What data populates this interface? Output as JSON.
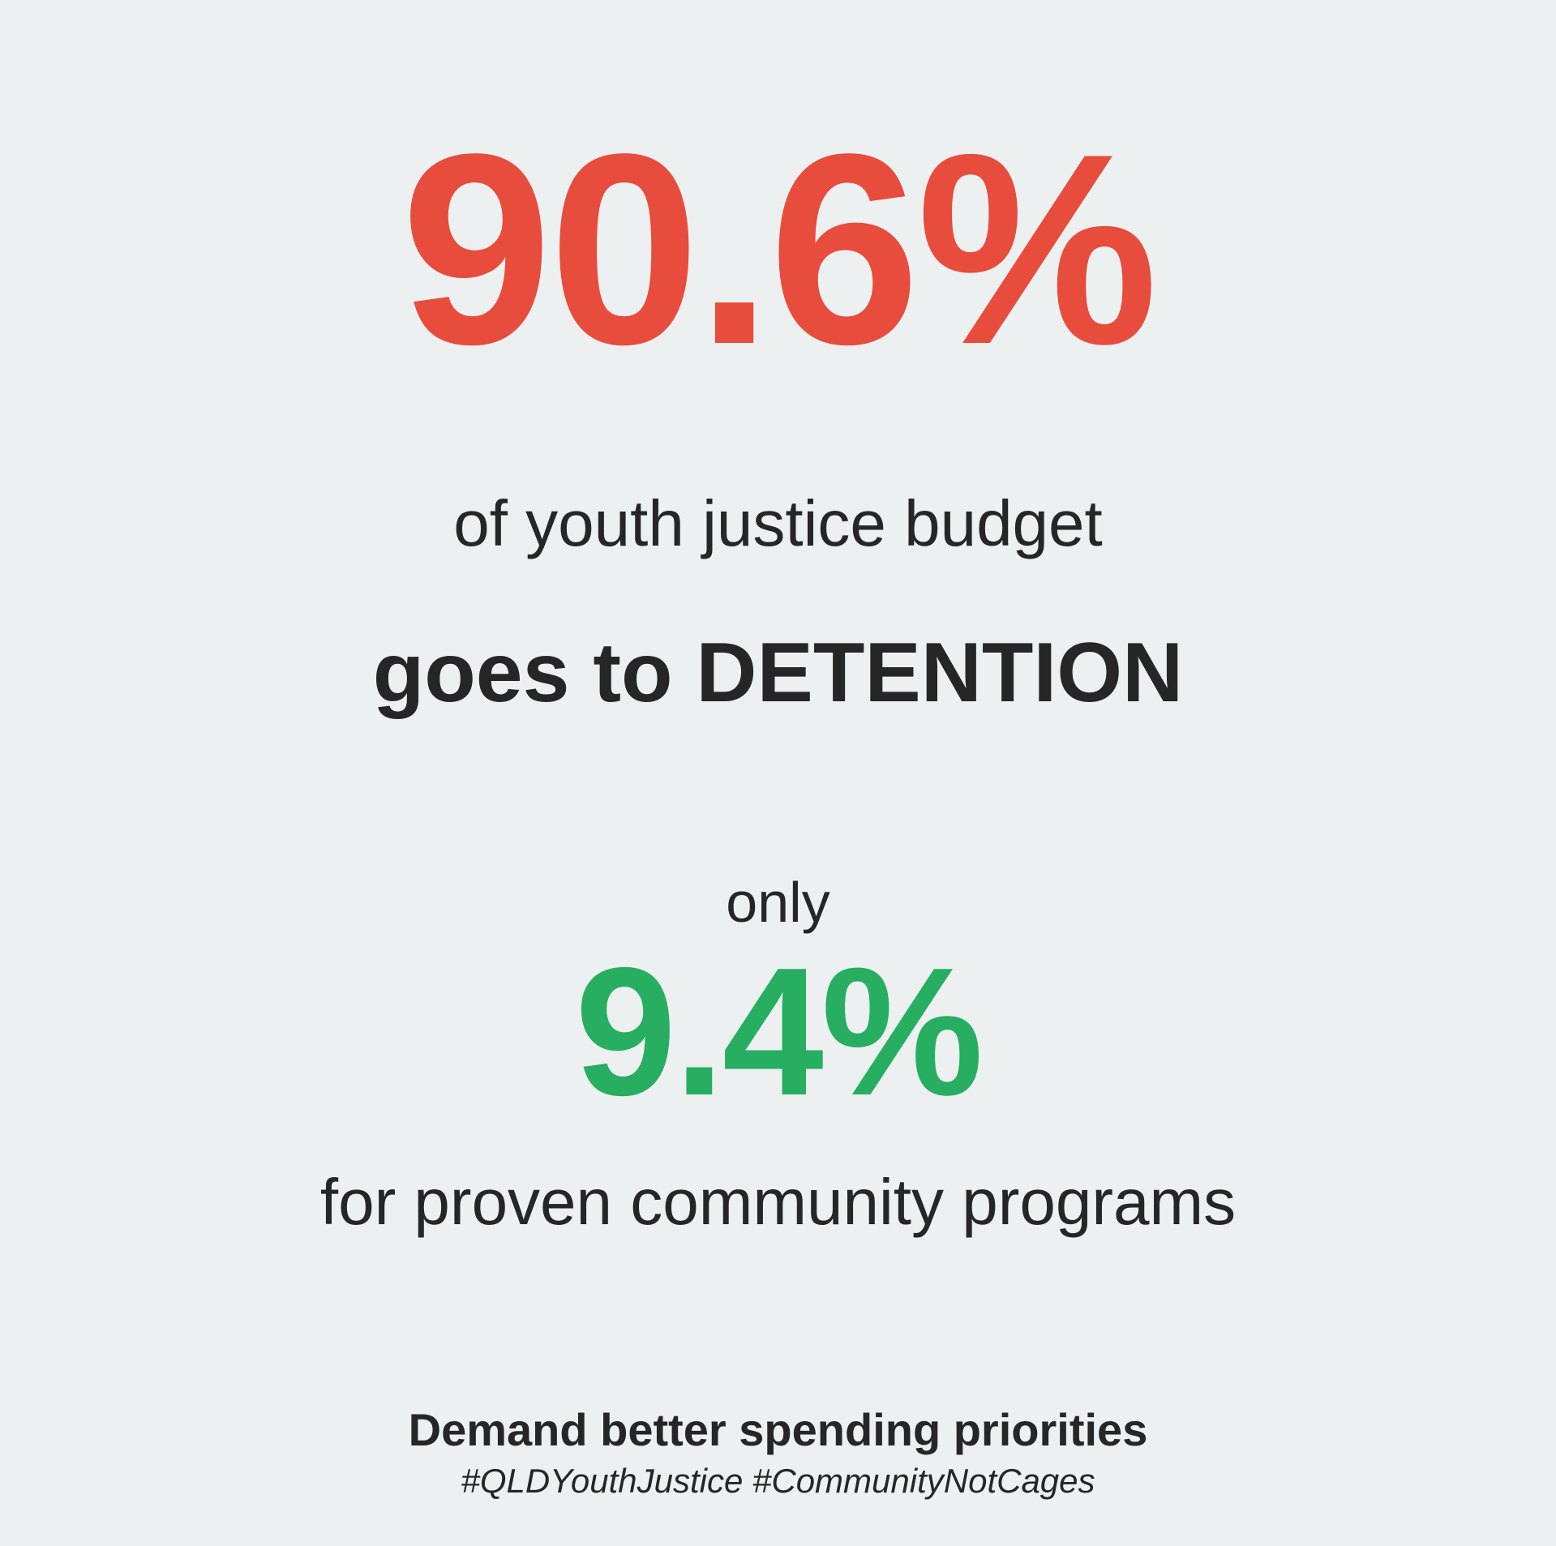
{
  "headline_percent": "90.6%",
  "line_budget": "of youth justice budget",
  "line_detention": "goes to DETENTION",
  "line_only": "only",
  "secondary_percent": "9.4%",
  "line_community": "for proven community programs",
  "call_to_action": "Demand better spending priorities",
  "hashtags": "#QLDYouthJustice #CommunityNotCages",
  "colors": {
    "background": "#ecf0f1",
    "detention_red": "#e74c3c",
    "community_green": "#27ae60",
    "text_dark": "#262626"
  }
}
